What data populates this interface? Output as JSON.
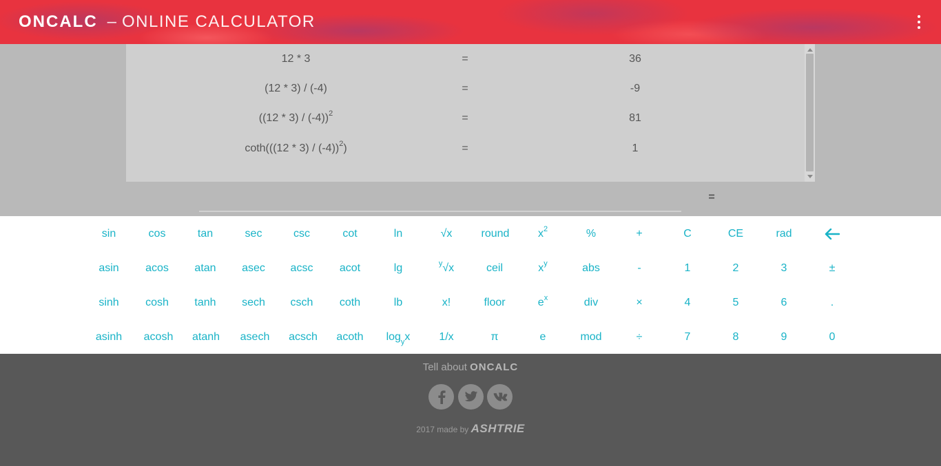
{
  "header": {
    "brand": "ONCALC",
    "separator": "–",
    "subtitle": "ONLINE CALCULATOR",
    "menu_icon": "more-vertical-icon"
  },
  "history": {
    "rows": [
      {
        "expr": "12 * 3",
        "eq": "=",
        "result": "36"
      },
      {
        "expr": "(12 * 3) / (-4)",
        "eq": "=",
        "result": "-9"
      },
      {
        "expr": "((12 * 3) / (-4))",
        "expr_sup": "2",
        "expr_tail": "",
        "eq": "=",
        "result": "81"
      },
      {
        "expr": "coth(((12 * 3) / (-4))",
        "expr_sup": "2",
        "expr_tail": ")",
        "eq": "=",
        "result": "1"
      }
    ]
  },
  "input": {
    "value": "",
    "eq": "="
  },
  "keypad": {
    "row1": [
      "sin",
      "cos",
      "tan",
      "sec",
      "csc",
      "cot",
      "ln",
      "√x",
      "round",
      "x",
      "%",
      "+",
      "C",
      "CE",
      "rad",
      "←"
    ],
    "row1_sup": {
      "x": "2"
    },
    "row2": [
      "asin",
      "acos",
      "atan",
      "asec",
      "acsc",
      "acot",
      "lg",
      "√x",
      "ceil",
      "x",
      "abs",
      "-",
      "1",
      "2",
      "3",
      "±"
    ],
    "row2_sup": {
      "yroot": "y",
      "xy": "y"
    },
    "row3": [
      "sinh",
      "cosh",
      "tanh",
      "sech",
      "csch",
      "coth",
      "lb",
      "x!",
      "floor",
      "e",
      "div",
      "×",
      "4",
      "5",
      "6",
      "."
    ],
    "row3_sup": {
      "ex": "x"
    },
    "row4": [
      "asinh",
      "acosh",
      "atanh",
      "asech",
      "acsch",
      "acoth",
      "log",
      "x",
      "1/x",
      "π",
      "e",
      "mod",
      "÷",
      "7",
      "8",
      "9",
      "0"
    ],
    "row4_sub": {
      "log": "y"
    }
  },
  "footer": {
    "tell": "Tell about",
    "tell_brand": "ONCALC",
    "social_icons": [
      "facebook-icon",
      "twitter-icon",
      "vk-icon"
    ],
    "made": "2017 made by",
    "made_brand": "ASHTRIE"
  },
  "colors": {
    "header_red": "#e8333f",
    "key_cyan": "#19b3c7",
    "footer_gray": "#585858"
  }
}
